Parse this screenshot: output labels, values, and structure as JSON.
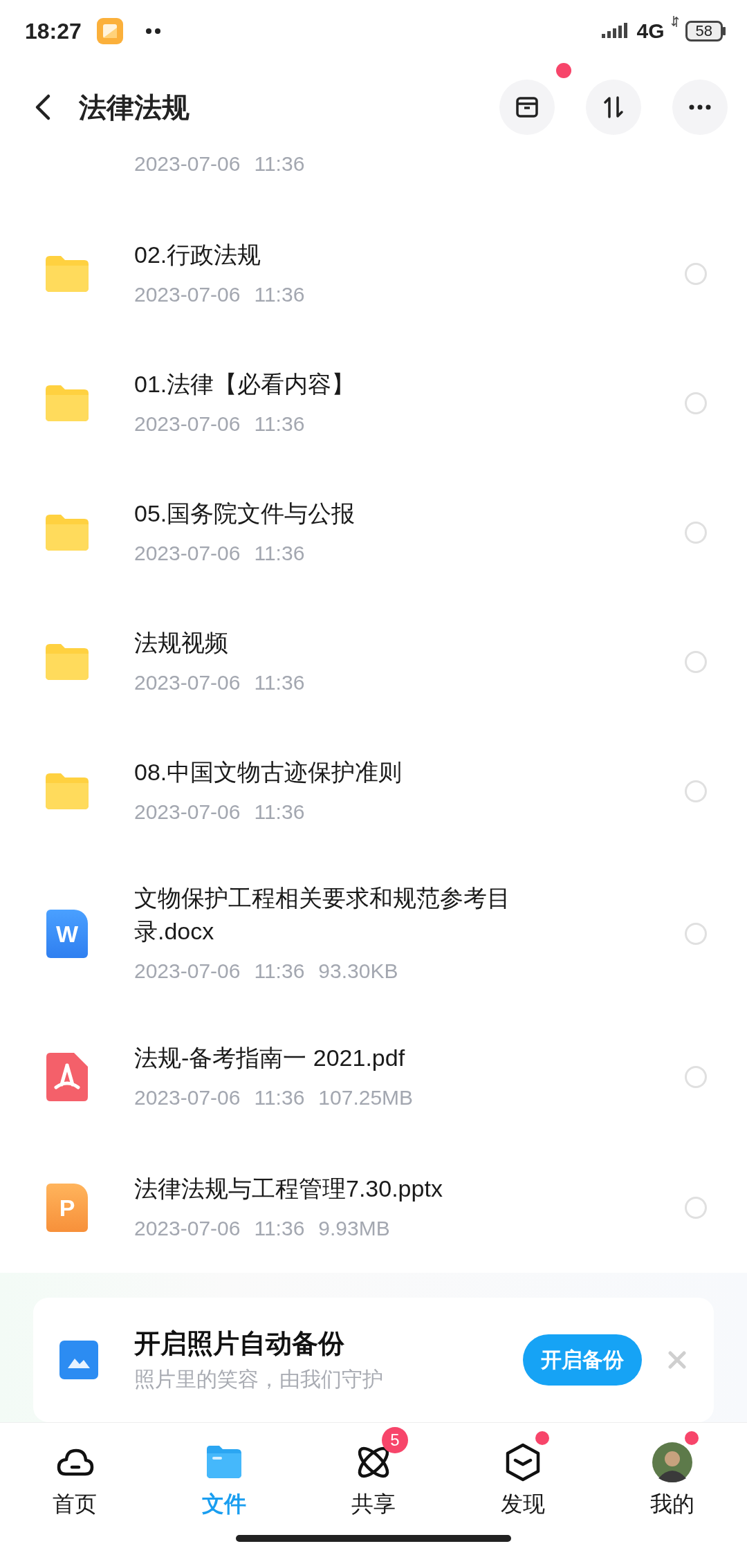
{
  "status_bar": {
    "time": "18:27",
    "network": "4G",
    "battery": "58"
  },
  "header": {
    "title": "法律法规",
    "actions": [
      {
        "kind": "archive",
        "dot": true
      },
      {
        "kind": "sort",
        "dot": false
      },
      {
        "kind": "more",
        "dot": false
      }
    ]
  },
  "partial_row": {
    "date": "2023-07-06",
    "time": "11:36"
  },
  "files": [
    {
      "kind": "folder",
      "name": "02.行政法规",
      "date": "2023-07-06",
      "time": "11:36",
      "selected": false
    },
    {
      "kind": "folder",
      "name": "01.法律【必看内容】",
      "date": "2023-07-06",
      "time": "11:36",
      "selected": false
    },
    {
      "kind": "folder",
      "name": "05.国务院文件与公报",
      "date": "2023-07-06",
      "time": "11:36",
      "selected": false
    },
    {
      "kind": "folder",
      "name": "法规视频",
      "date": "2023-07-06",
      "time": "11:36",
      "selected": false
    },
    {
      "kind": "folder",
      "name": "08.中国文物古迹保护准则",
      "date": "2023-07-06",
      "time": "11:36",
      "selected": false
    },
    {
      "kind": "docx",
      "icon_letter": "W",
      "name": "文物保护工程相关要求和规范参考目录.docx",
      "date": "2023-07-06",
      "time": "11:36",
      "size": "93.30KB",
      "selected": false
    },
    {
      "kind": "pdf",
      "name": "法规-备考指南一 2021.pdf",
      "date": "2023-07-06",
      "time": "11:36",
      "size": "107.25MB",
      "selected": false
    },
    {
      "kind": "pptx",
      "icon_letter": "P",
      "name": "法律法规与工程管理7.30.pptx",
      "date": "2023-07-06",
      "time": "11:36",
      "size": "9.93MB",
      "selected": false
    }
  ],
  "banner": {
    "title": "开启照片自动备份",
    "subtitle": "照片里的笑容，由我们守护",
    "button": "开启备份"
  },
  "nav": [
    {
      "kind": "cloud",
      "label": "首页",
      "selected": false,
      "dot": false
    },
    {
      "kind": "folder",
      "label": "文件",
      "selected": true,
      "dot": false
    },
    {
      "kind": "atom",
      "label": "共享",
      "selected": false,
      "dot": false,
      "badge": "5"
    },
    {
      "kind": "cube",
      "label": "发现",
      "selected": false,
      "dot": true
    },
    {
      "kind": "avatar",
      "label": "我的",
      "selected": false,
      "dot": true
    }
  ]
}
